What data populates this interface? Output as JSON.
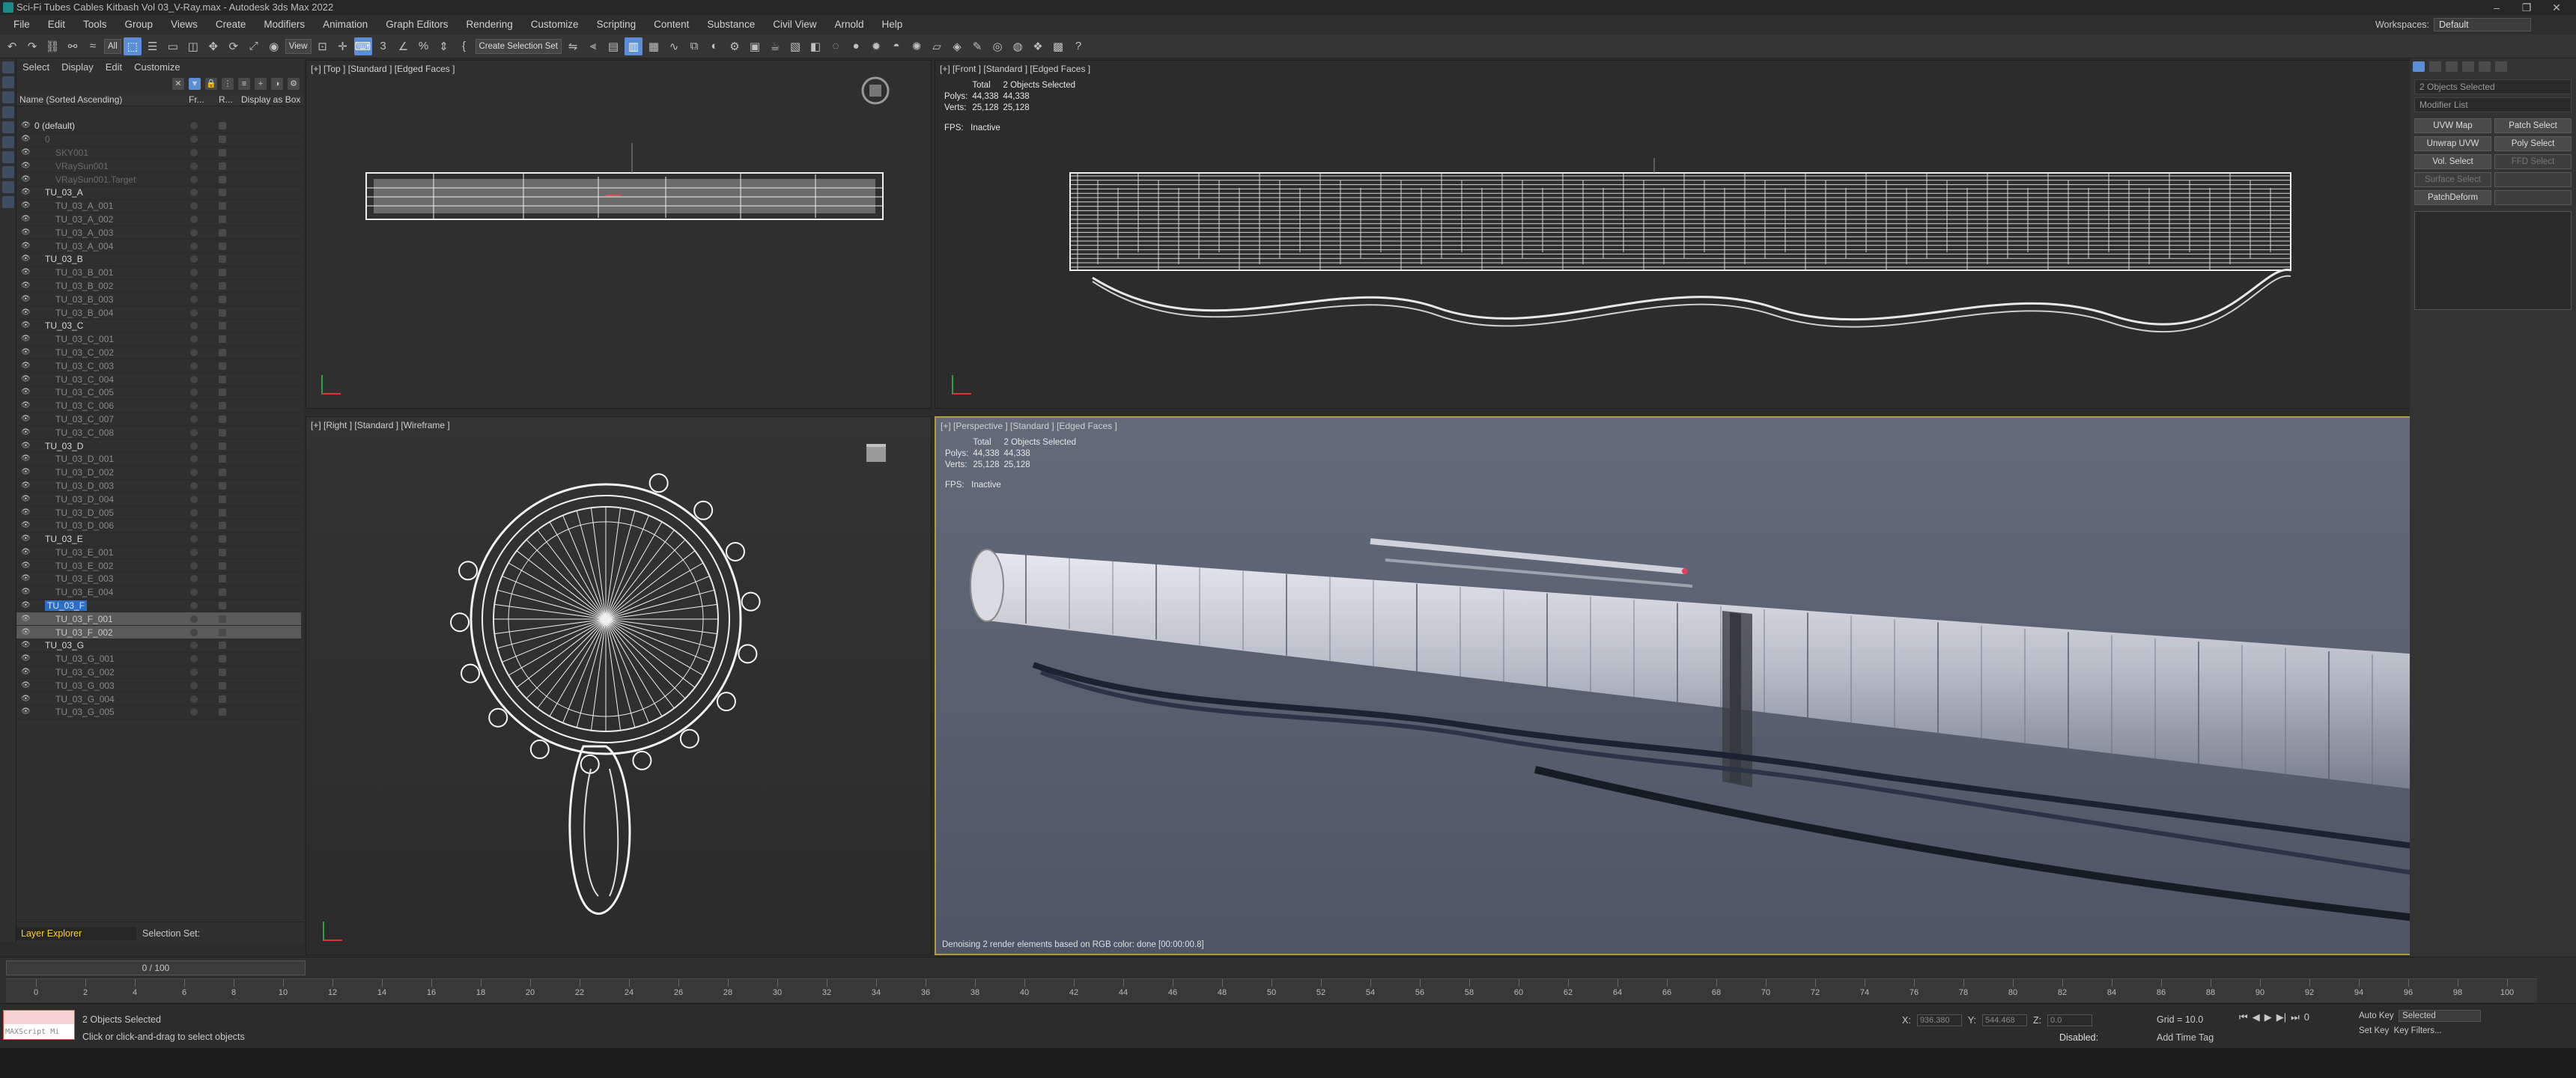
{
  "title": "Sci-Fi Tubes Cables Kitbash Vol 03_V-Ray.max - Autodesk 3ds Max 2022",
  "window_controls": [
    "–",
    "❐",
    "✕"
  ],
  "menu": [
    "File",
    "Edit",
    "Tools",
    "Group",
    "Views",
    "Create",
    "Modifiers",
    "Animation",
    "Graph Editors",
    "Rendering",
    "Customize",
    "Scripting",
    "Content",
    "Substance",
    "Civil View",
    "Arnold",
    "Help"
  ],
  "workspace": {
    "label": "Workspaces:",
    "value": "Default"
  },
  "toolbar": {
    "filter": "All",
    "view": "View",
    "selection_set": "Create Selection Set"
  },
  "explorer": {
    "tabs": [
      "Select",
      "Display",
      "Edit",
      "Customize"
    ],
    "headers": {
      "name": "Name (Sorted Ascending)",
      "frozen": "Fr...",
      "render": "R...",
      "display": "Display as Box"
    },
    "rows": [
      {
        "label": "0 (default)",
        "kind": "grp",
        "indent": 0
      },
      {
        "label": "0",
        "kind": "dim",
        "indent": 1
      },
      {
        "label": "SKY001",
        "kind": "dim",
        "indent": 2
      },
      {
        "label": "VRaySun001",
        "kind": "dim",
        "indent": 2
      },
      {
        "label": "VRaySun001.Target",
        "kind": "dim",
        "indent": 2
      },
      {
        "label": "TU_03_A",
        "kind": "grp",
        "indent": 1
      },
      {
        "label": "TU_03_A_001",
        "kind": "child",
        "indent": 2
      },
      {
        "label": "TU_03_A_002",
        "kind": "child",
        "indent": 2
      },
      {
        "label": "TU_03_A_003",
        "kind": "child",
        "indent": 2
      },
      {
        "label": "TU_03_A_004",
        "kind": "child",
        "indent": 2
      },
      {
        "label": "TU_03_B",
        "kind": "grp",
        "indent": 1
      },
      {
        "label": "TU_03_B_001",
        "kind": "child",
        "indent": 2
      },
      {
        "label": "TU_03_B_002",
        "kind": "child",
        "indent": 2
      },
      {
        "label": "TU_03_B_003",
        "kind": "child",
        "indent": 2
      },
      {
        "label": "TU_03_B_004",
        "kind": "child",
        "indent": 2
      },
      {
        "label": "TU_03_C",
        "kind": "grp",
        "indent": 1
      },
      {
        "label": "TU_03_C_001",
        "kind": "child",
        "indent": 2
      },
      {
        "label": "TU_03_C_002",
        "kind": "child",
        "indent": 2
      },
      {
        "label": "TU_03_C_003",
        "kind": "child",
        "indent": 2
      },
      {
        "label": "TU_03_C_004",
        "kind": "child",
        "indent": 2
      },
      {
        "label": "TU_03_C_005",
        "kind": "child",
        "indent": 2
      },
      {
        "label": "TU_03_C_006",
        "kind": "child",
        "indent": 2
      },
      {
        "label": "TU_03_C_007",
        "kind": "child",
        "indent": 2
      },
      {
        "label": "TU_03_C_008",
        "kind": "child",
        "indent": 2
      },
      {
        "label": "TU_03_D",
        "kind": "grp",
        "indent": 1
      },
      {
        "label": "TU_03_D_001",
        "kind": "child",
        "indent": 2
      },
      {
        "label": "TU_03_D_002",
        "kind": "child",
        "indent": 2
      },
      {
        "label": "TU_03_D_003",
        "kind": "child",
        "indent": 2
      },
      {
        "label": "TU_03_D_004",
        "kind": "child",
        "indent": 2
      },
      {
        "label": "TU_03_D_005",
        "kind": "child",
        "indent": 2
      },
      {
        "label": "TU_03_D_006",
        "kind": "child",
        "indent": 2
      },
      {
        "label": "TU_03_E",
        "kind": "grp",
        "indent": 1
      },
      {
        "label": "TU_03_E_001",
        "kind": "child",
        "indent": 2
      },
      {
        "label": "TU_03_E_002",
        "kind": "child",
        "indent": 2
      },
      {
        "label": "TU_03_E_003",
        "kind": "child",
        "indent": 2
      },
      {
        "label": "TU_03_E_004",
        "kind": "child",
        "indent": 2
      },
      {
        "label": "TU_03_F",
        "kind": "hl",
        "indent": 1
      },
      {
        "label": "TU_03_F_001",
        "kind": "sel",
        "indent": 2
      },
      {
        "label": "TU_03_F_002",
        "kind": "sel",
        "indent": 2
      },
      {
        "label": "TU_03_G",
        "kind": "grp",
        "indent": 1
      },
      {
        "label": "TU_03_G_001",
        "kind": "child",
        "indent": 2
      },
      {
        "label": "TU_03_G_002",
        "kind": "child",
        "indent": 2
      },
      {
        "label": "TU_03_G_003",
        "kind": "child",
        "indent": 2
      },
      {
        "label": "TU_03_G_004",
        "kind": "child",
        "indent": 2
      },
      {
        "label": "TU_03_G_005",
        "kind": "child",
        "indent": 2
      }
    ],
    "footer_left": "Layer Explorer",
    "footer_right": "Selection Set:"
  },
  "viewports": {
    "top": {
      "label": "[+] [Top ] [Standard ] [Edged Faces ]"
    },
    "front": {
      "label": "[+] [Front ] [Standard ] [Edged Faces ]",
      "stats": {
        "h1": "Total",
        "h2": "2 Objects Selected",
        "polys_label": "Polys:",
        "polys_total": "44,338",
        "polys_sel": "44,338",
        "verts_label": "Verts:",
        "verts_total": "25,128",
        "verts_sel": "25,128",
        "fps_label": "FPS:",
        "fps_value": "Inactive"
      }
    },
    "right": {
      "label": "[+] [Right ] [Standard ] [Wireframe ]"
    },
    "perspective": {
      "label": "[+] [Perspective ] [Standard ] [Edged Faces ]",
      "stats": {
        "h1": "Total",
        "h2": "2 Objects Selected",
        "polys_label": "Polys:",
        "polys_total": "44,338",
        "polys_sel": "44,338",
        "verts_label": "Verts:",
        "verts_total": "25,128",
        "verts_sel": "25,128",
        "fps_label": "FPS:",
        "fps_value": "Inactive"
      },
      "footer": "Denoising 2 render elements based on RGB color: done [00:00:00.8]"
    }
  },
  "command_panel": {
    "objects": "2 Objects Selected",
    "modifier_list": "Modifier List",
    "buttons": [
      {
        "label": "UVW Map",
        "enabled": true
      },
      {
        "label": "Patch Select",
        "enabled": true
      },
      {
        "label": "Unwrap UVW",
        "enabled": true
      },
      {
        "label": "Poly Select",
        "enabled": true
      },
      {
        "label": "Vol. Select",
        "enabled": true
      },
      {
        "label": "FFD Select",
        "enabled": false
      },
      {
        "label": "Surface Select",
        "enabled": false
      },
      {
        "label": "",
        "enabled": false
      },
      {
        "label": "PatchDeform",
        "enabled": true
      },
      {
        "label": "",
        "enabled": false
      }
    ]
  },
  "timeline": {
    "slider": "0 / 100",
    "ticks": [
      "0",
      "2",
      "4",
      "6",
      "8",
      "10",
      "12",
      "14",
      "16",
      "18",
      "20",
      "22",
      "24",
      "26",
      "28",
      "30",
      "32",
      "34",
      "36",
      "38",
      "40",
      "42",
      "44",
      "46",
      "48",
      "50",
      "52",
      "54",
      "56",
      "58",
      "60",
      "62",
      "64",
      "66",
      "68",
      "70",
      "72",
      "74",
      "76",
      "78",
      "80",
      "82",
      "84",
      "86",
      "88",
      "90",
      "92",
      "94",
      "96",
      "98",
      "100"
    ]
  },
  "status": {
    "maxscript": "MAXScript Mi",
    "line1": "2 Objects Selected",
    "line2": "Click or click-and-drag to select objects",
    "x_label": "X:",
    "x_val": "936.380",
    "y_label": "Y:",
    "y_val": "544.468",
    "z_label": "Z:",
    "z_val": "0.0",
    "grid": "Grid = 10.0",
    "add_time_tag": "Add Time Tag",
    "disabled": "Disabled:",
    "auto_key": "Auto Key",
    "selected": "Selected",
    "set_key": "Set Key",
    "key_filters": "Key Filters...",
    "frame": "0"
  }
}
